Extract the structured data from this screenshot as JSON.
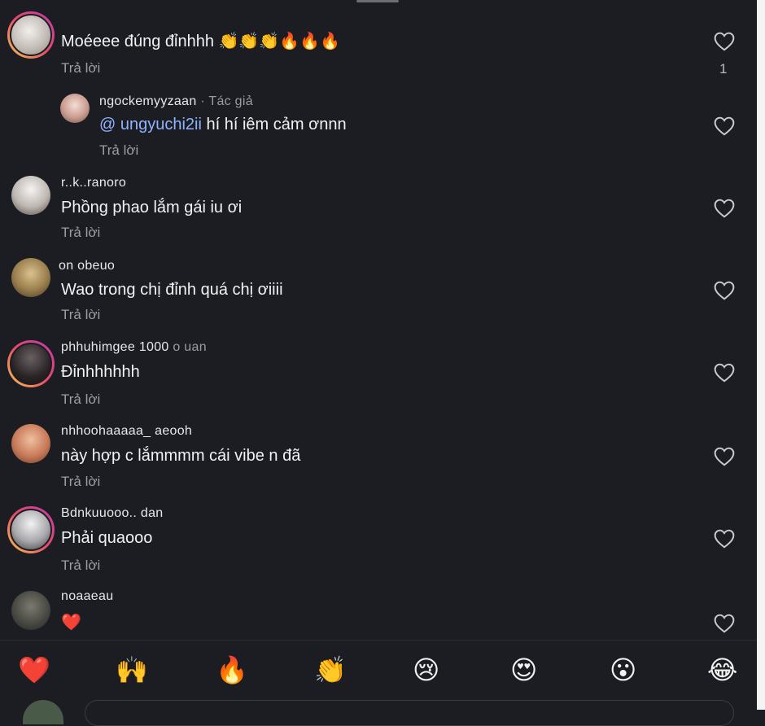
{
  "comments": [
    {
      "username": "",
      "text": "Moéeee đúng đỉnhhh 👏👏👏🔥🔥🔥",
      "reply_label": "Trả lời",
      "like_count": "1",
      "avatar_color": "#d9d4d0"
    },
    {
      "username": "ngockemyyzaan",
      "badge": "· Tác giả",
      "mention": "@ ungyuchi2ii",
      "text": "hí hí iêm cảm ơnnn",
      "reply_label": "Trả lời",
      "avatar_color": "#e8c8c0"
    },
    {
      "username": "r..k..ranoro",
      "text": "Phồng phao lắm gái iu ơi",
      "reply_label": "Trả lời",
      "avatar_color": "#cfc9c3"
    },
    {
      "username": "on            obeuo",
      "text": "Wao trong chị đỉnh quá chị ơiiii",
      "reply_label": "Trả lời",
      "avatar_color": "#b59a6a"
    },
    {
      "username": "phhuhimgee 1000",
      "username_suffix": "o uan",
      "text": "Đỉnhhhhhh",
      "reply_label": "Trả lời",
      "avatar_color": "#3a3436"
    },
    {
      "username": "nhhoohaaaaa_ aeooh",
      "text": "này hợp c lắmmmm cái vibe n đã",
      "reply_label": "Trả lời",
      "avatar_color": "#e0a888"
    },
    {
      "username": "Bdnkuuooo..  dan",
      "text": "Phải quaooo",
      "reply_label": "Trả lời",
      "avatar_color": "#d6d6d8"
    },
    {
      "username": "noaaeau",
      "text": "❤️",
      "reply_label": "",
      "avatar_color": "#4a4a44"
    }
  ],
  "emoji_bar": [
    "❤️",
    "🙌",
    "🔥",
    "👏",
    "😢",
    "😍",
    "😮",
    "😂"
  ],
  "colors": {
    "background": "#1b1d22",
    "text": "#f2f2f4",
    "secondary": "#9c9ea4",
    "mention": "#8fb3ff"
  }
}
